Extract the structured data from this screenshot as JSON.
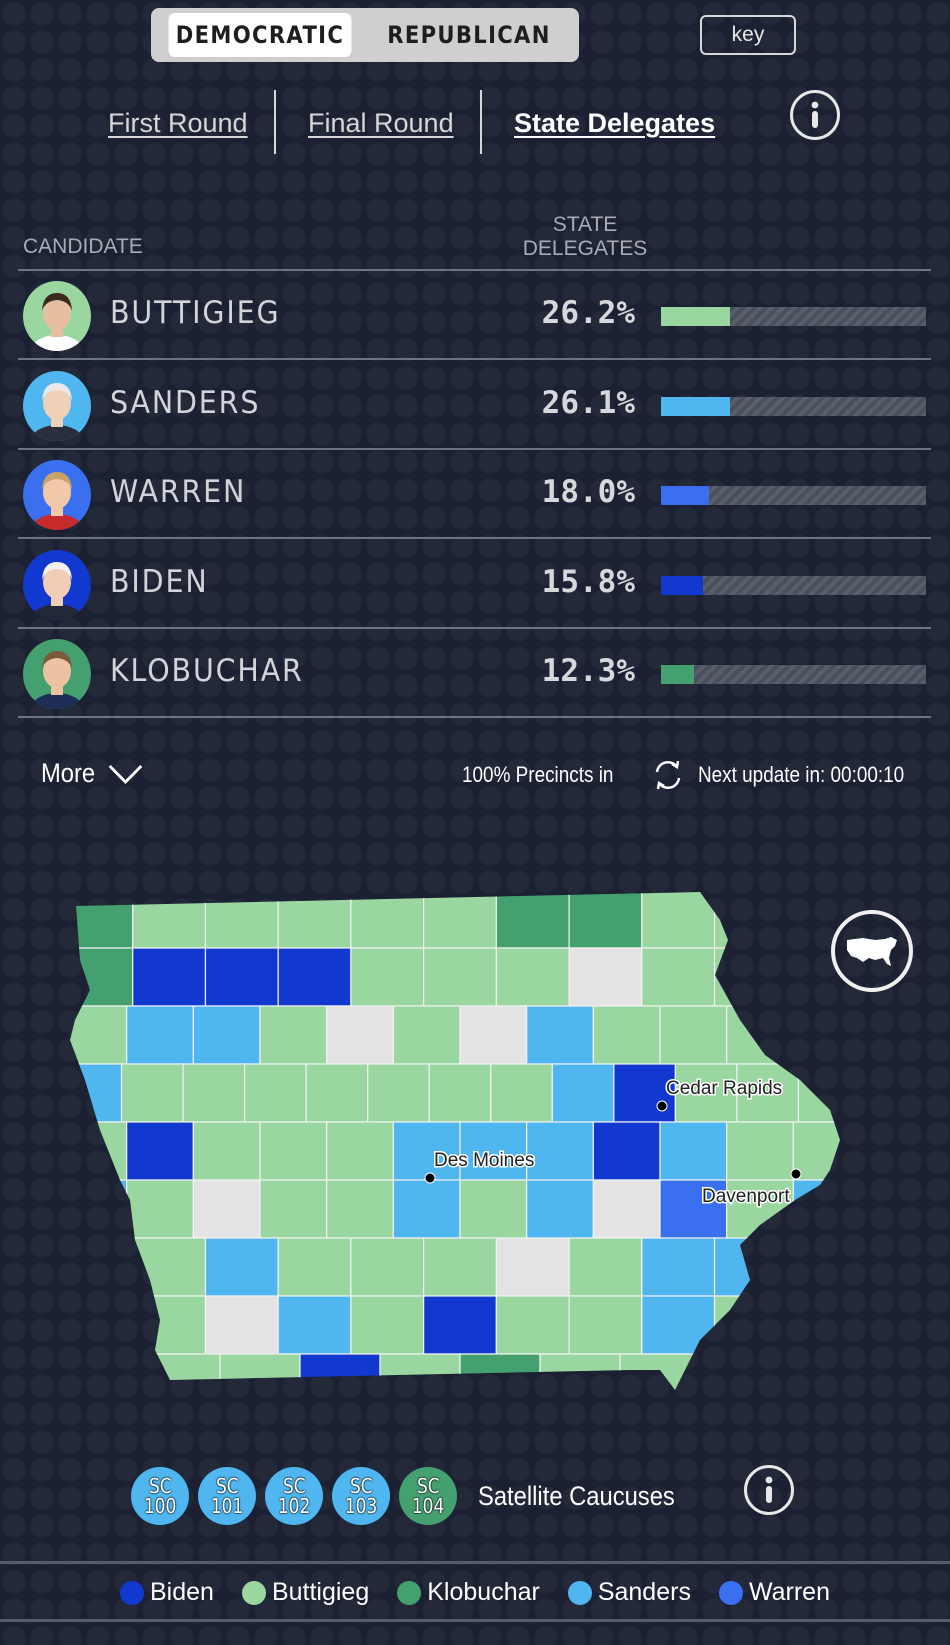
{
  "party_toggle": {
    "options": [
      "DEMOCRATIC",
      "REPUBLICAN"
    ],
    "selected": "DEMOCRATIC"
  },
  "key_button": "key",
  "round_tabs": {
    "items": [
      "First Round",
      "Final Round",
      "State Delegates"
    ],
    "active": "State Delegates"
  },
  "table": {
    "col_candidate": "CANDIDATE",
    "col_metric_line1": "STATE",
    "col_metric_line2": "DELEGATES",
    "rows": [
      {
        "name": "BUTTIGIEG",
        "pct_label": "26.2%",
        "pct": 26.2,
        "color": "#9ad6a0"
      },
      {
        "name": "SANDERS",
        "pct_label": "26.1%",
        "pct": 26.1,
        "color": "#4fb6ef"
      },
      {
        "name": "WARREN",
        "pct_label": "18.0%",
        "pct": 18.0,
        "color": "#3a70f0"
      },
      {
        "name": "BIDEN",
        "pct_label": "15.8%",
        "pct": 15.8,
        "color": "#1239cf"
      },
      {
        "name": "KLOBUCHAR",
        "pct_label": "12.3%",
        "pct": 12.3,
        "color": "#45a070"
      }
    ]
  },
  "more_label": "More",
  "precincts_label": "100% Precincts in",
  "next_update_label": "Next update in: 00:00:10",
  "map": {
    "cities": [
      "Cedar Rapids",
      "Des Moines",
      "Davenport"
    ],
    "colors": {
      "biden": "#1239cf",
      "buttigieg": "#9ad6a0",
      "klobuchar": "#45a070",
      "sanders": "#4fb6ef",
      "warren": "#3a70f0",
      "none": "#e3e3e3"
    },
    "county_rows": [
      [
        "klobuchar",
        "buttigieg",
        "buttigieg",
        "buttigieg",
        "buttigieg",
        "buttigieg",
        "klobuchar",
        "klobuchar",
        "buttigieg",
        "buttigieg",
        "buttigieg"
      ],
      [
        "klobuchar",
        "biden",
        "biden",
        "biden",
        "buttigieg",
        "buttigieg",
        "buttigieg",
        "none",
        "buttigieg",
        "buttigieg",
        "buttigieg"
      ],
      [
        "buttigieg",
        "sanders",
        "sanders",
        "buttigieg",
        "none",
        "buttigieg",
        "none",
        "sanders",
        "buttigieg",
        "buttigieg",
        "buttigieg",
        "buttigieg"
      ],
      [
        "sanders",
        "buttigieg",
        "buttigieg",
        "buttigieg",
        "buttigieg",
        "buttigieg",
        "buttigieg",
        "buttigieg",
        "sanders",
        "biden",
        "buttigieg",
        "buttigieg",
        "buttigieg"
      ],
      [
        "buttigieg",
        "biden",
        "buttigieg",
        "buttigieg",
        "buttigieg",
        "sanders",
        "sanders",
        "sanders",
        "biden",
        "sanders",
        "buttigieg",
        "buttigieg"
      ],
      [
        "sanders",
        "buttigieg",
        "none",
        "buttigieg",
        "buttigieg",
        "sanders",
        "buttigieg",
        "sanders",
        "none",
        "warren",
        "buttigieg",
        "sanders"
      ],
      [
        "sanders",
        "buttigieg",
        "sanders",
        "buttigieg",
        "buttigieg",
        "buttigieg",
        "none",
        "buttigieg",
        "sanders",
        "sanders",
        "sanders"
      ],
      [
        "buttigieg",
        "buttigieg",
        "none",
        "sanders",
        "buttigieg",
        "biden",
        "buttigieg",
        "buttigieg",
        "sanders",
        "buttigieg",
        "buttigieg"
      ],
      [
        "buttigieg",
        "buttigieg",
        "buttigieg",
        "biden",
        "buttigieg",
        "klobuchar",
        "buttigieg",
        "buttigieg",
        "buttigieg",
        "buttigieg"
      ]
    ]
  },
  "satellite_caucuses": {
    "label": "Satellite Caucuses",
    "items": [
      {
        "code": "SC",
        "num": "100",
        "winner": "sanders"
      },
      {
        "code": "SC",
        "num": "101",
        "winner": "sanders"
      },
      {
        "code": "SC",
        "num": "102",
        "winner": "sanders"
      },
      {
        "code": "SC",
        "num": "103",
        "winner": "sanders"
      },
      {
        "code": "SC",
        "num": "104",
        "winner": "klobuchar"
      }
    ]
  },
  "legend": [
    {
      "label": "Biden",
      "color": "#1239cf"
    },
    {
      "label": "Buttigieg",
      "color": "#9ad6a0"
    },
    {
      "label": "Klobuchar",
      "color": "#45a070"
    },
    {
      "label": "Sanders",
      "color": "#4fb6ef"
    },
    {
      "label": "Warren",
      "color": "#3a70f0"
    }
  ]
}
